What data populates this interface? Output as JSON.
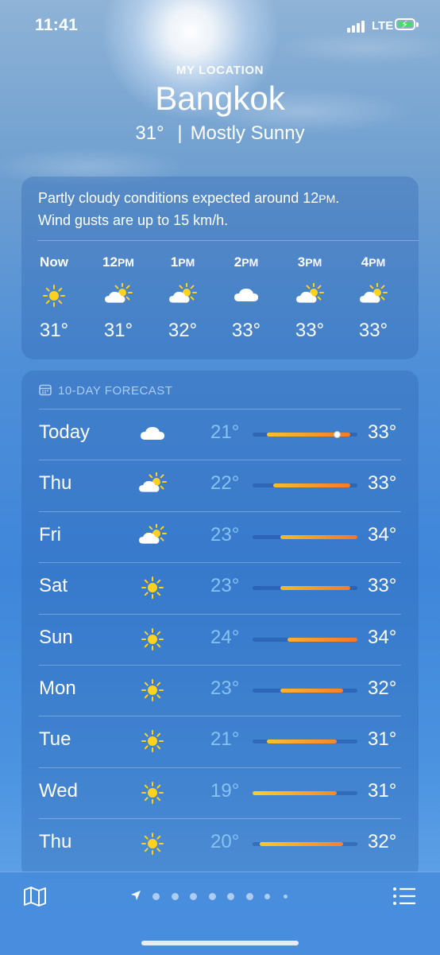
{
  "status": {
    "time": "11:41",
    "network": "LTE"
  },
  "header": {
    "label": "MY LOCATION",
    "city": "Bangkok",
    "temp": "31°",
    "separator": "|",
    "condition": "Mostly Sunny"
  },
  "hourly": {
    "summary_pre": "Partly cloudy conditions expected around 12",
    "summary_pm": "PM",
    "summary_post": ".",
    "summary_line2": "Wind gusts are up to 15 km/h.",
    "hours": [
      {
        "label": "Now",
        "suffix": "",
        "icon": "sun-icon",
        "temp": "31°"
      },
      {
        "label": "12",
        "suffix": "PM",
        "icon": "partly-cloudy-icon",
        "temp": "31°"
      },
      {
        "label": "1",
        "suffix": "PM",
        "icon": "partly-cloudy-icon",
        "temp": "32°"
      },
      {
        "label": "2",
        "suffix": "PM",
        "icon": "cloud-icon",
        "temp": "33°"
      },
      {
        "label": "3",
        "suffix": "PM",
        "icon": "partly-cloudy-icon",
        "temp": "33°"
      },
      {
        "label": "4",
        "suffix": "PM",
        "icon": "partly-cloudy-icon",
        "temp": "33°"
      }
    ]
  },
  "forecast": {
    "title": "10-DAY FORECAST",
    "range_low": 19,
    "range_high": 34,
    "current_temp": 31,
    "days": [
      {
        "day": "Today",
        "icon": "cloud-icon",
        "low": "21°",
        "high": "33°",
        "low_val": 21,
        "high_val": 33
      },
      {
        "day": "Thu",
        "icon": "partly-cloudy-icon",
        "low": "22°",
        "high": "33°",
        "low_val": 22,
        "high_val": 33
      },
      {
        "day": "Fri",
        "icon": "partly-cloudy-icon",
        "low": "23°",
        "high": "34°",
        "low_val": 23,
        "high_val": 34
      },
      {
        "day": "Sat",
        "icon": "sun-icon",
        "low": "23°",
        "high": "33°",
        "low_val": 23,
        "high_val": 33
      },
      {
        "day": "Sun",
        "icon": "sun-icon",
        "low": "24°",
        "high": "34°",
        "low_val": 24,
        "high_val": 34
      },
      {
        "day": "Mon",
        "icon": "sun-icon",
        "low": "23°",
        "high": "32°",
        "low_val": 23,
        "high_val": 32
      },
      {
        "day": "Tue",
        "icon": "sun-icon",
        "low": "21°",
        "high": "31°",
        "low_val": 21,
        "high_val": 31
      },
      {
        "day": "Wed",
        "icon": "sun-icon",
        "low": "19°",
        "high": "31°",
        "low_val": 19,
        "high_val": 31
      },
      {
        "day": "Thu",
        "icon": "sun-icon",
        "low": "20°",
        "high": "32°",
        "low_val": 20,
        "high_val": 32
      }
    ]
  },
  "bottom": {
    "map_icon": "map-icon",
    "list_icon": "list-icon",
    "location_icon": "location-arrow-icon",
    "page_count": 9
  },
  "colors": {
    "sun": "#ffd21e",
    "bar_cool": "#f7cf2f",
    "bar_warm": "#f3762b",
    "low_text": "#86c2f3"
  }
}
